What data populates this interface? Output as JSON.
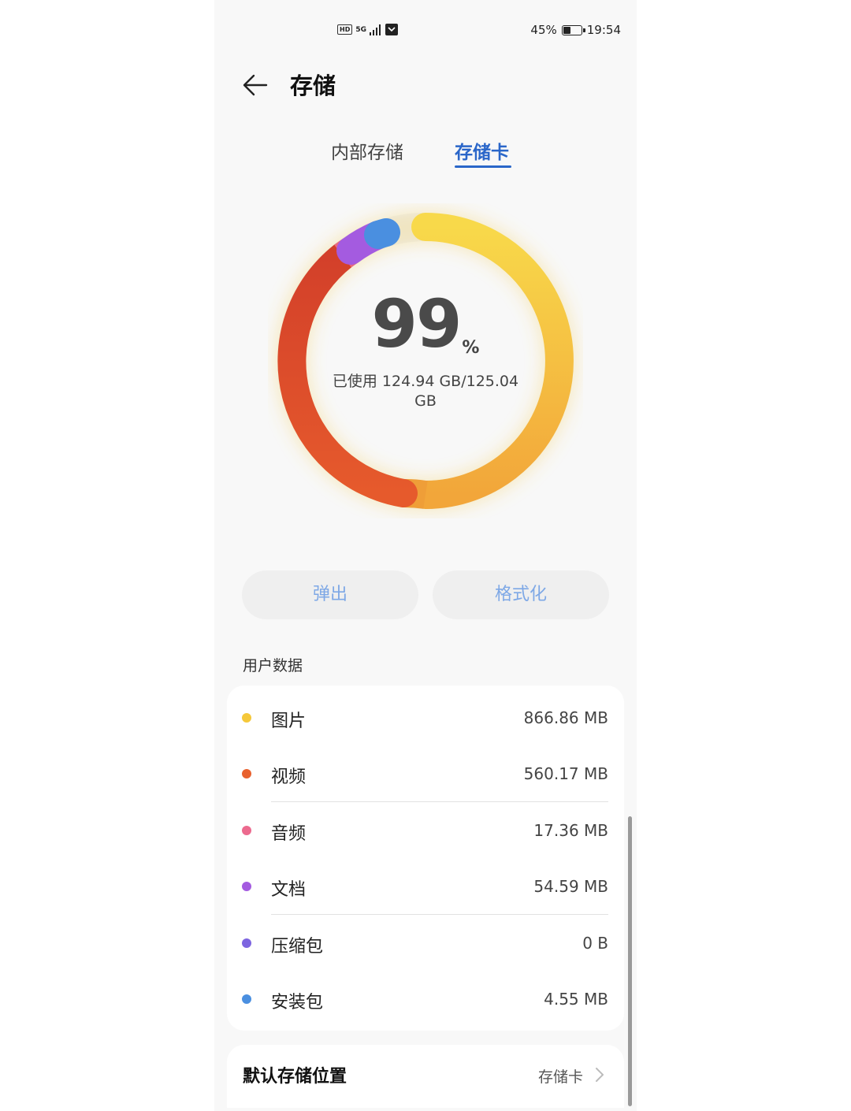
{
  "status_bar": {
    "network": "HD",
    "signal": "5G",
    "battery_percent": "45%",
    "battery_level": 0.45,
    "time": "19:54"
  },
  "header": {
    "back_icon": "arrow-left-icon",
    "title": "存储"
  },
  "tabs": [
    {
      "label": "内部存储",
      "selected": false
    },
    {
      "label": "存储卡",
      "selected": true
    }
  ],
  "usage": {
    "percent": "99",
    "percent_sign": "%",
    "used_text": "已使用 124.94 GB/125.04 GB"
  },
  "actions": {
    "eject_label": "弹出",
    "format_label": "格式化"
  },
  "user_data": {
    "section_label": "用户数据",
    "items": [
      {
        "label": "图片",
        "value": "866.86 MB",
        "color": "#f5c83a"
      },
      {
        "label": "视频",
        "value": "560.17 MB",
        "color": "#e8612e"
      },
      {
        "label": "音频",
        "value": "17.36 MB",
        "color": "#ec6a8e"
      },
      {
        "label": "文档",
        "value": "54.59 MB",
        "color": "#a45be0"
      },
      {
        "label": "压缩包",
        "value": "0 B",
        "color": "#7d65e0"
      },
      {
        "label": "安装包",
        "value": "4.55 MB",
        "color": "#4a8fe0"
      }
    ]
  },
  "default_storage": {
    "label": "默认存储位置",
    "value": "存储卡",
    "chevron_icon": "chevron-right-icon"
  },
  "ring_colors": {
    "yellow": "#f7d64a",
    "orange": "#f2a93a",
    "red": "#d8452a",
    "pink": "#e8697f",
    "purple": "#a45be0",
    "blue": "#4a8fe0",
    "track": "#ececec"
  }
}
